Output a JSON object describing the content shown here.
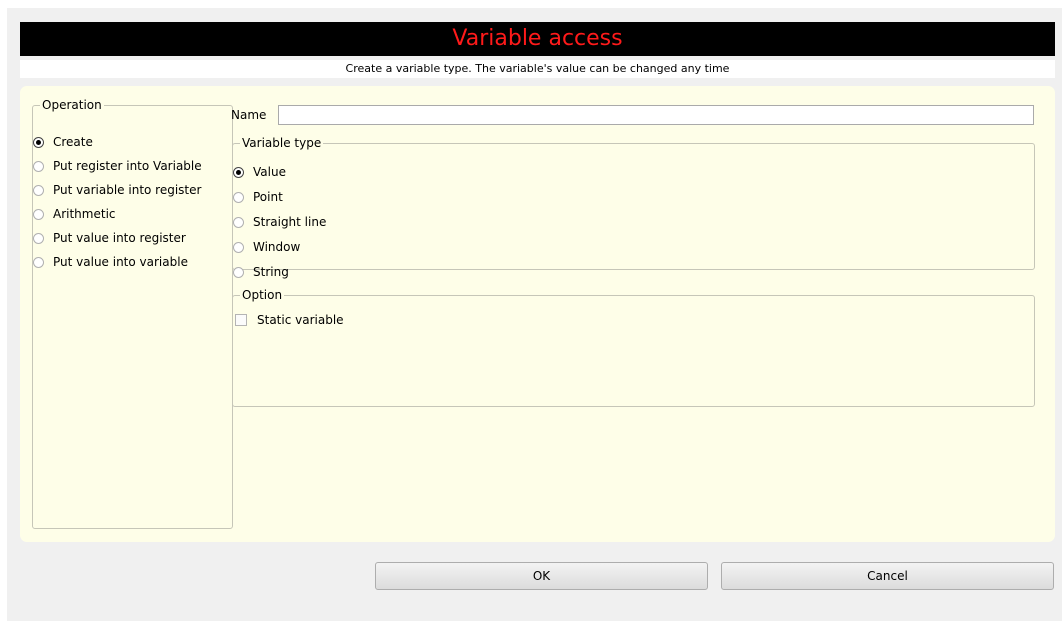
{
  "window": {
    "title": "Variable access",
    "subtitle": "Create a variable type. The variable's value can be changed any time"
  },
  "operation": {
    "legend": "Operation",
    "options": [
      {
        "label": "Create",
        "checked": true
      },
      {
        "label": "Put register into Variable",
        "checked": false
      },
      {
        "label": "Put variable  into register",
        "checked": false
      },
      {
        "label": "Arithmetic",
        "checked": false
      },
      {
        "label": "Put value  into register",
        "checked": false
      },
      {
        "label": "Put value  into variable",
        "checked": false
      }
    ]
  },
  "name_field": {
    "label": "Name",
    "value": ""
  },
  "variable_type": {
    "legend": "Variable type",
    "options": [
      {
        "label": "Value",
        "checked": true
      },
      {
        "label": "Point",
        "checked": false
      },
      {
        "label": "Straight line",
        "checked": false
      },
      {
        "label": "Window",
        "checked": false
      },
      {
        "label": "String",
        "checked": false
      }
    ]
  },
  "option": {
    "legend": "Option",
    "static_variable_label": "Static  variable",
    "static_variable_checked": false
  },
  "buttons": {
    "ok": "OK",
    "cancel": "Cancel"
  },
  "colors": {
    "title_bg": "#000000",
    "title_text": "#ff1a1a",
    "panel_bg": "#fefee8",
    "dialog_bg": "#f0f0f0"
  }
}
